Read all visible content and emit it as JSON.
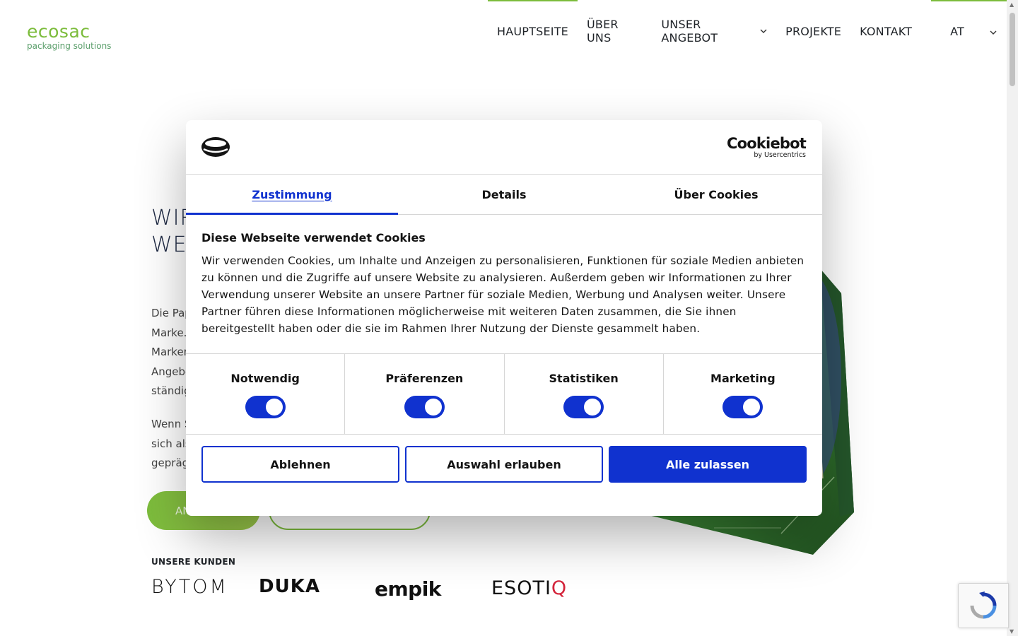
{
  "site": {
    "logo_word": "ecosac",
    "logo_sub": "packaging solutions"
  },
  "nav": {
    "items": [
      {
        "label": "HAUPTSEITE"
      },
      {
        "label": "ÜBER UNS"
      },
      {
        "label": "UNSER ANGEBOT"
      },
      {
        "label": "PROJEKTE"
      },
      {
        "label": "KONTAKT"
      }
    ],
    "language": "AT"
  },
  "hero": {
    "title_line1": "WIR",
    "title_line2": "WEI",
    "para1_lines": [
      "Die Pap",
      "Marke.",
      "Marken",
      "Angebo",
      "ständig"
    ],
    "para2_lines": [
      "Wenn S",
      "sich als",
      "gepräg"
    ],
    "primary_button": "AN",
    "clients_label": "UNSERE KUNDEN",
    "clients": {
      "bytom": "BYTOM",
      "duka": "DUKA",
      "empik": "empik",
      "esotiq_main": "ESOTI",
      "esotiq_end": "Q"
    }
  },
  "cookie_dialog": {
    "brand": "Cookiebot",
    "brand_by": "by Usercentrics",
    "tabs": [
      {
        "label": "Zustimmung"
      },
      {
        "label": "Details"
      },
      {
        "label": "Über Cookies"
      }
    ],
    "title": "Diese Webseite verwendet Cookies",
    "body": "Wir verwenden Cookies, um Inhalte und Anzeigen zu personalisieren, Funktionen für soziale Medien anbieten zu können und die Zugriffe auf unsere Website zu analysieren. Außerdem geben wir Informationen zu Ihrer Verwendung unserer Website an unsere Partner für soziale Medien, Werbung und Analysen weiter. Unsere Partner führen diese Informationen möglicherweise mit weiteren Daten zusammen, die Sie ihnen bereitgestellt haben oder die sie im Rahmen Ihrer Nutzung der Dienste gesammelt haben.",
    "toggles": [
      {
        "label": "Notwendig",
        "on": true
      },
      {
        "label": "Präferenzen",
        "on": true
      },
      {
        "label": "Statistiken",
        "on": true
      },
      {
        "label": "Marketing",
        "on": true
      }
    ],
    "buttons": {
      "decline": "Ablehnen",
      "allow_selection": "Auswahl erlauben",
      "allow_all": "Alle zulassen"
    },
    "accent_color": "#1032cf"
  },
  "colors": {
    "brand_green": "#7cbc3c",
    "cookiebot_blue": "#1032cf"
  }
}
